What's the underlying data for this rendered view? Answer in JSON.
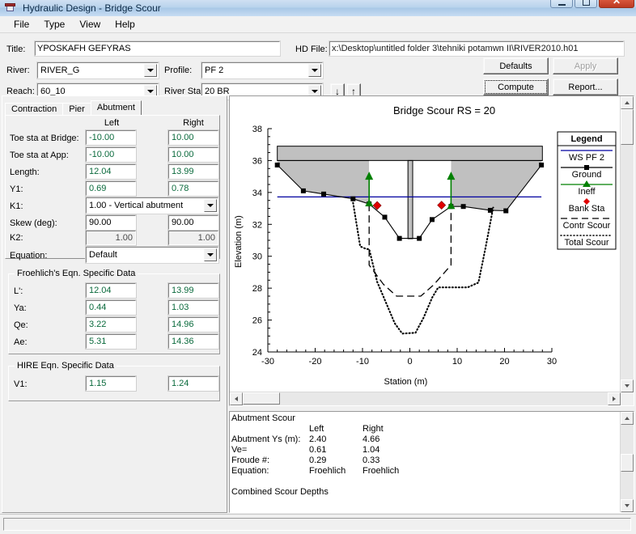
{
  "window": {
    "title": "Hydraulic Design - Bridge Scour",
    "icon": "bridge-icon",
    "minimize": "–",
    "maximize": "□",
    "close": "✕"
  },
  "menubar": {
    "items": [
      {
        "label": "File"
      },
      {
        "label": "Type"
      },
      {
        "label": "View"
      },
      {
        "label": "Help"
      }
    ]
  },
  "topform": {
    "title_label": "Title:",
    "title_value": "YPOSKAFH GEFYRAS",
    "hdfile_label": "HD File:",
    "hdfile_value": "x:\\Desktop\\untitled folder 3\\tehniki potamwn II\\RIVER2010.h01",
    "river_label": "River:",
    "river_value": "RIVER_G",
    "profile_label": "Profile:",
    "profile_value": "PF 2",
    "reach_label": "Reach:",
    "reach_value": "60_10",
    "riversta_label": "River Sta.:",
    "riversta_value": "20    BR",
    "down_arrow": "↓",
    "up_arrow": "↑",
    "defaults_button": "Defaults",
    "apply_button": "Apply",
    "compute_button": "Compute",
    "report_button": "Report..."
  },
  "tabs": [
    {
      "label": "Contraction",
      "active": false
    },
    {
      "label": "Pier",
      "active": false
    },
    {
      "label": "Abutment",
      "active": true
    }
  ],
  "abutment": {
    "col_left": "Left",
    "col_right": "Right",
    "rows": [
      {
        "label": "Toe sta at Bridge:",
        "left": "-10.00",
        "right": "10.00",
        "type": "field"
      },
      {
        "label": "Toe sta at App:",
        "left": "-10.00",
        "right": "10.00",
        "type": "field"
      },
      {
        "label": "Length:",
        "left": "12.04",
        "right": "13.99",
        "type": "field"
      },
      {
        "label": "Y1:",
        "left": "0.69",
        "right": "0.78",
        "type": "field"
      }
    ],
    "k1_label": "K1:",
    "k1_value": "1.00 - Vertical abutment",
    "skew_label": "Skew (deg):",
    "skew_left": "90.00",
    "skew_right": "90.00",
    "k2_label": "K2:",
    "k2_left": "1.00",
    "k2_right": "1.00",
    "equation_label": "Equation:",
    "equation_value": "Default"
  },
  "froehlich": {
    "group_label": "Froehlich's Eqn. Specific Data",
    "rows": [
      {
        "label": "L':",
        "left": "12.04",
        "right": "13.99"
      },
      {
        "label": "Ya:",
        "left": "0.44",
        "right": "1.03"
      },
      {
        "label": "Qe:",
        "left": "3.22",
        "right": "14.96"
      },
      {
        "label": "Ae:",
        "left": "5.31",
        "right": "14.36"
      }
    ]
  },
  "hire": {
    "group_label": "HIRE Eqn. Specific Data",
    "rows": [
      {
        "label": "V1:",
        "left": "1.15",
        "right": "1.24"
      }
    ]
  },
  "chart_data": {
    "type": "line",
    "title": "Bridge Scour RS = 20",
    "xlabel": "Station (m)",
    "ylabel": "Elevation (m)",
    "xlim": [
      -30,
      30
    ],
    "ylim": [
      24,
      38
    ],
    "xticks": [
      -30,
      -20,
      -10,
      0,
      10,
      20,
      30
    ],
    "yticks": [
      24,
      26,
      28,
      30,
      32,
      34,
      36,
      38
    ],
    "grid": false,
    "legend_title": "Legend",
    "legend_position": "right",
    "legend": [
      {
        "name": "WS PF 2",
        "color": "#0000a0",
        "style": "solid-line",
        "marker": "none"
      },
      {
        "name": "Ground",
        "color": "#000000",
        "style": "solid-line",
        "marker": "square"
      },
      {
        "name": "Ineff",
        "color": "#008000",
        "style": "solid-line",
        "marker": "triangle"
      },
      {
        "name": "Bank Sta",
        "color": "#e00000",
        "style": "none",
        "marker": "diamond"
      },
      {
        "name": "Contr Scour",
        "color": "#000000",
        "style": "dashed-line",
        "marker": "none"
      },
      {
        "name": "Total Scour",
        "color": "#000000",
        "style": "dotted-line",
        "marker": "none"
      }
    ],
    "water_surface_elevation": 33.72,
    "bridge_deck": {
      "x0": -28.0,
      "x1": 28.0,
      "top": 36.9,
      "bottom": 36.0
    },
    "pier": {
      "x0": -0.4,
      "x1": 0.6,
      "top": 36.0,
      "bottom": 31.1
    },
    "opening_left": {
      "x0": -8.6,
      "x1": -0.4,
      "top": 36.0,
      "bottom": 31.1
    },
    "opening_right": {
      "x0": 0.6,
      "x1": 8.7,
      "top": 36.0,
      "bottom": 31.1
    },
    "series": [
      {
        "name": "Ground",
        "marker": "square",
        "x": [
          -28.0,
          -22.5,
          -18.2,
          -12.0,
          -8.6,
          -5.3,
          -2.2,
          2.0,
          4.7,
          8.7,
          11.3,
          17.0,
          20.3,
          27.8
        ],
        "y": [
          35.72,
          34.1,
          33.9,
          33.6,
          33.28,
          32.45,
          31.12,
          31.12,
          32.3,
          33.12,
          33.12,
          32.88,
          32.85,
          35.72
        ]
      },
      {
        "name": "WS PF 2",
        "x": [
          -28.0,
          27.8
        ],
        "y": [
          33.72,
          33.72
        ]
      },
      {
        "name": "Ineff",
        "marker": "triangle",
        "x": [
          -8.6,
          -8.6,
          8.7,
          8.7
        ],
        "y": [
          33.28,
          35.1,
          33.12,
          35.1
        ]
      },
      {
        "name": "Bank Sta",
        "marker": "diamond",
        "x": [
          -6.9,
          6.7
        ],
        "y": [
          33.18,
          33.2
        ]
      },
      {
        "name": "Contr Scour",
        "style": "dashed",
        "x": [
          -8.6,
          -8.6,
          -5.6,
          -2.8,
          2.3,
          5.0,
          8.7,
          8.7
        ],
        "y": [
          33.28,
          29.45,
          28.25,
          27.5,
          27.5,
          28.2,
          29.45,
          33.12
        ]
      },
      {
        "name": "Total Scour",
        "style": "dotted",
        "x": [
          -12.1,
          -10.8,
          -10.5,
          -9.2,
          -8.6,
          -6.9,
          -5.2,
          -3.2,
          -1.6,
          1.2,
          2.9,
          4.7,
          6.0,
          8.7,
          12.2,
          14.5,
          16.0,
          17.6
        ],
        "y": [
          33.55,
          31.2,
          30.62,
          30.45,
          30.45,
          28.4,
          27.2,
          25.8,
          25.15,
          25.2,
          26.15,
          27.4,
          28.05,
          28.05,
          28.05,
          28.35,
          30.55,
          33.05
        ]
      }
    ],
    "abutment_scour_left": 2.4,
    "abutment_scour_right": 4.66
  },
  "results": {
    "heading": "Abutment Scour",
    "col_label_left": "Left",
    "col_label_right": "Right",
    "rows": [
      {
        "label": "",
        "left": "Left",
        "right": "Right"
      },
      {
        "label": "Abutment Ys (m):",
        "left": "2.40",
        "right": "4.66"
      },
      {
        "label": "Ve=",
        "left": "0.61",
        "right": "1.04"
      },
      {
        "label": "Froude #:",
        "left": "0.29",
        "right": "0.33"
      },
      {
        "label": "Equation:",
        "left": "Froehlich",
        "right": "Froehlich"
      }
    ],
    "footer": "Combined Scour Depths"
  },
  "statusbar": {
    "text": ""
  },
  "colors": {
    "water": "#0000a0",
    "ground": "#000000",
    "ineff": "#008000",
    "bank": "#e00000",
    "deck_fill": "#c0c0c0",
    "field_text": "#0a6a3c"
  }
}
